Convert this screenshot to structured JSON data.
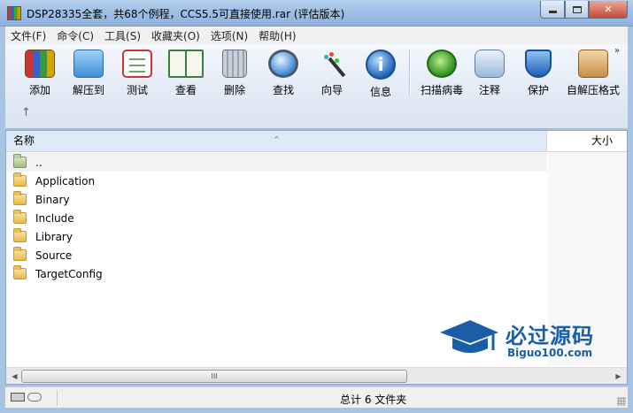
{
  "window": {
    "title": "DSP28335全套，共68个例程，CCS5.5可直接使用.rar (评估版本)",
    "icon": "winrar-archive-icon",
    "close_glyph": "✕"
  },
  "menu": [
    "文件(F)",
    "命令(C)",
    "工具(S)",
    "收藏夹(O)",
    "选项(N)",
    "帮助(H)"
  ],
  "toolbar": {
    "buttons": [
      {
        "label": "添加",
        "icon": "add-archive-icon"
      },
      {
        "label": "解压到",
        "icon": "extract-folder-icon"
      },
      {
        "label": "测试",
        "icon": "test-checklist-icon"
      },
      {
        "label": "查看",
        "icon": "view-book-icon"
      },
      {
        "label": "删除",
        "icon": "trash-can-icon"
      },
      {
        "label": "查找",
        "icon": "magnifier-icon"
      },
      {
        "label": "向导",
        "icon": "wizard-wand-icon"
      },
      {
        "label": "信息",
        "icon": "info-icon"
      },
      {
        "label": "扫描病毒",
        "icon": "virus-scan-icon"
      },
      {
        "label": "注释",
        "icon": "comment-icon"
      },
      {
        "label": "保护",
        "icon": "shield-icon"
      },
      {
        "label": "自解压格式",
        "icon": "sfx-box-icon"
      }
    ],
    "overflow": "»",
    "up_arrow": "↑"
  },
  "columns": {
    "name": "名称",
    "size": "大小",
    "sort_indicator": "^"
  },
  "files": [
    {
      "name": "..",
      "type": "parent"
    },
    {
      "name": "Application",
      "type": "folder"
    },
    {
      "name": "Binary",
      "type": "folder"
    },
    {
      "name": "Include",
      "type": "folder"
    },
    {
      "name": "Library",
      "type": "folder"
    },
    {
      "name": "Source",
      "type": "folder"
    },
    {
      "name": "TargetConfig",
      "type": "folder"
    }
  ],
  "watermark": {
    "title": "必过源码",
    "subtitle": "Biguo100.com"
  },
  "scrollbar": {
    "left": "◀",
    "right": "▶",
    "grip": "III"
  },
  "status": {
    "text": "总计 6 文件夹"
  },
  "colors": {
    "accent": "#1a5ea8",
    "header_sort": "#ddeaf7"
  }
}
